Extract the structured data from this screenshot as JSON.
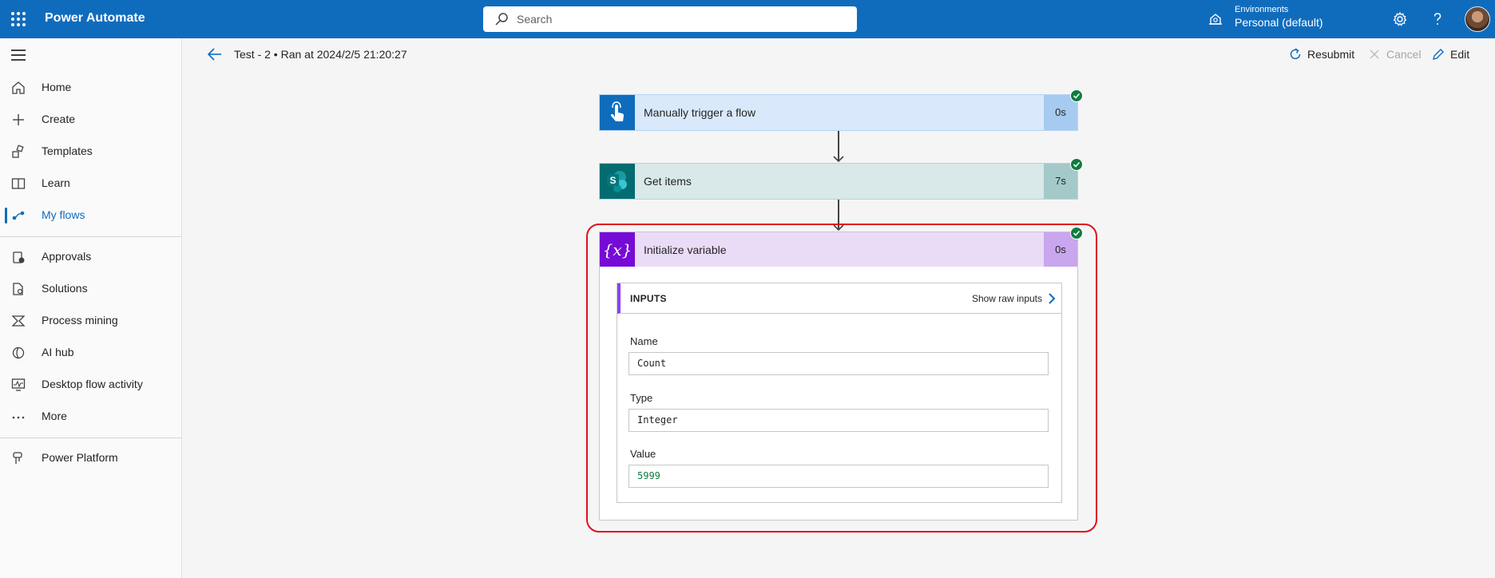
{
  "topbar": {
    "app_title": "Power Automate",
    "search_placeholder": "Search",
    "env_label": "Environments",
    "env_value": "Personal (default)"
  },
  "nav": {
    "items": [
      {
        "label": "Home",
        "icon": "home-icon"
      },
      {
        "label": "Create",
        "icon": "plus-icon"
      },
      {
        "label": "Templates",
        "icon": "templates-icon"
      },
      {
        "label": "Learn",
        "icon": "book-icon"
      },
      {
        "label": "My flows",
        "icon": "flows-icon",
        "active": true
      },
      {
        "label": "Approvals",
        "icon": "approvals-icon"
      },
      {
        "label": "Solutions",
        "icon": "solutions-icon"
      },
      {
        "label": "Process mining",
        "icon": "process-mining-icon"
      },
      {
        "label": "AI hub",
        "icon": "ai-hub-icon"
      },
      {
        "label": "Desktop flow activity",
        "icon": "desktop-activity-icon"
      },
      {
        "label": "More",
        "icon": "more-icon"
      },
      {
        "label": "Power Platform",
        "icon": "power-platform-icon"
      }
    ]
  },
  "cmdbar": {
    "run_title": "Test - 2 • Ran at 2024/2/5 21:20:27",
    "resubmit": "Resubmit",
    "cancel": "Cancel",
    "edit": "Edit"
  },
  "flow": {
    "steps": [
      {
        "title": "Manually trigger a flow",
        "duration": "0s",
        "status": "succeeded"
      },
      {
        "title": "Get items",
        "duration": "7s",
        "status": "succeeded"
      },
      {
        "title": "Initialize variable",
        "duration": "0s",
        "status": "succeeded"
      }
    ],
    "inputs": {
      "header": "INPUTS",
      "raw_link": "Show raw inputs",
      "fields": [
        {
          "label": "Name",
          "value": "Count"
        },
        {
          "label": "Type",
          "value": "Integer"
        },
        {
          "label": "Value",
          "value": "5999"
        }
      ]
    }
  },
  "colors": {
    "brand": "#0f6cbd",
    "trigger": "#d9e9fb",
    "sharepoint": "#d9e8e8",
    "variable": "#eadcf7",
    "success": "#107c41",
    "highlight": "#e0101a"
  }
}
